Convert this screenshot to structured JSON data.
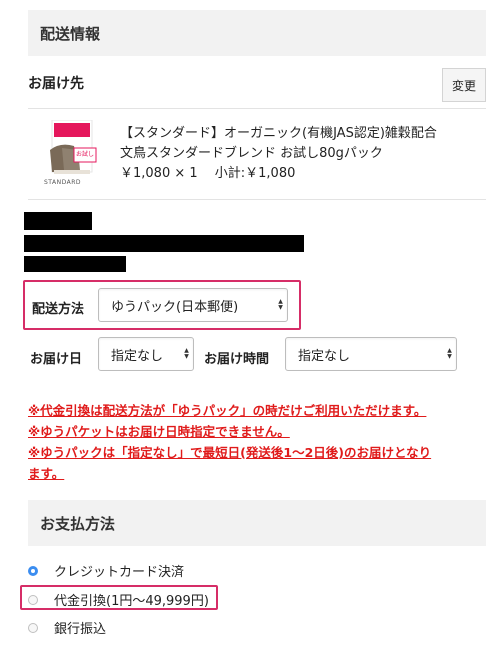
{
  "shipping_section": {
    "title": "配送情報"
  },
  "recipient": {
    "label": "お届け先",
    "change_button": "変更"
  },
  "product": {
    "image_tag": "お試し",
    "image_brand": "STANDARD",
    "name_line1": "【スタンダード】オーガニック(有機JAS認定)雑穀配合",
    "name_line2": "文鳥スタンダードブレンド お試し80gパック",
    "price_line": "￥1,080 × 1　 小計:￥1,080"
  },
  "delivery": {
    "method_label": "配送方法",
    "method_value": "ゆうパック(日本郵便)",
    "date_label": "お届け日",
    "date_value": "指定なし",
    "time_label": "お届け時間",
    "time_value": "指定なし"
  },
  "notices": [
    "※代金引換は配送方法が「ゆうパック」の時だけご利用いただけます。",
    "※ゆうパケットはお届け日時指定できません。",
    "※ゆうパックは「指定なし」で最短日(発送後1〜2日後)のお届けとなり",
    "ます。"
  ],
  "payment_section": {
    "title": "お支払方法"
  },
  "payment_options": [
    {
      "label": "クレジットカード決済",
      "checked": true
    },
    {
      "label": "代金引換(1円〜49,999円)",
      "checked": false
    },
    {
      "label": "銀行振込",
      "checked": false
    }
  ],
  "colors": {
    "highlight": "#d62d67",
    "notice": "#e01b1b",
    "radio_selected": "#3b8df0"
  }
}
